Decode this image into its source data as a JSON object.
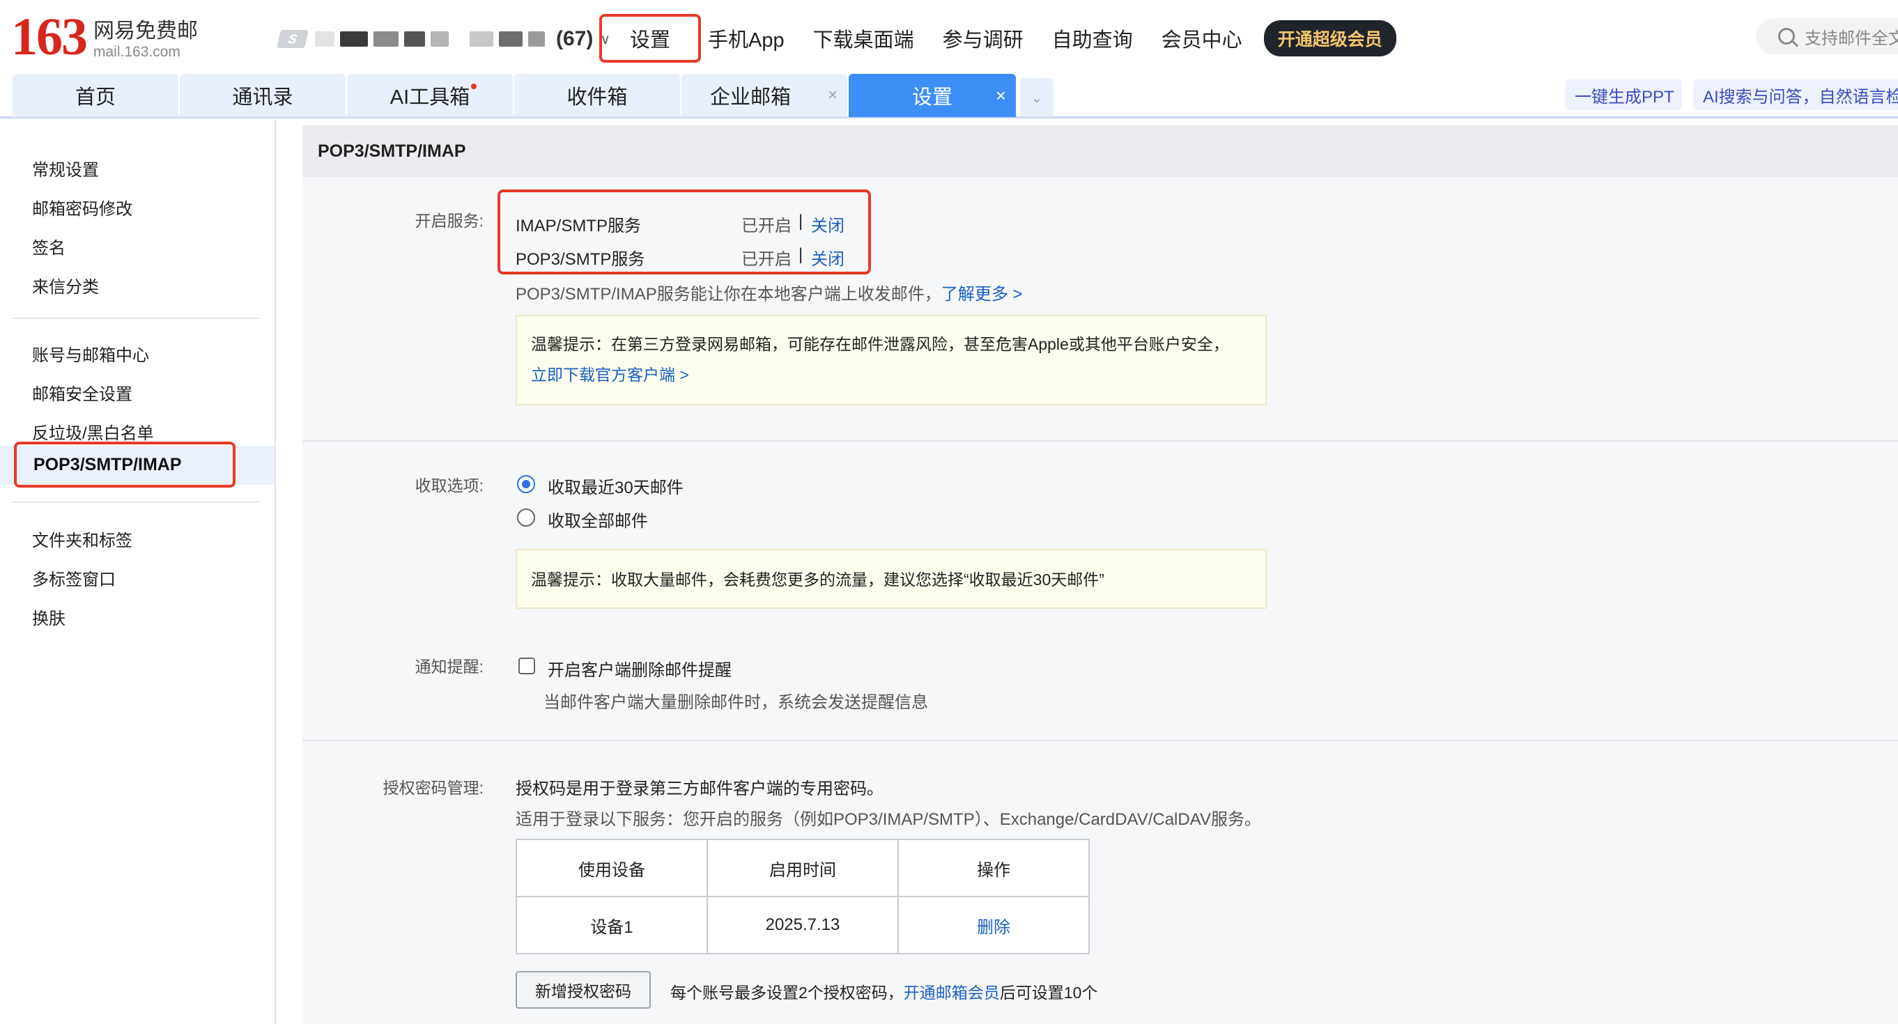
{
  "logo": {
    "number": "163",
    "name": "网易免费邮",
    "domain": "mail.163.com"
  },
  "account": {
    "badge": "S",
    "count": "(67)"
  },
  "topnav": {
    "items": [
      "设置",
      "手机App",
      "下载桌面端",
      "参与调研",
      "自助查询",
      "会员中心"
    ],
    "vip": "开通超级会员"
  },
  "search": {
    "placeholder": "支持邮件全文"
  },
  "tabs": {
    "items": [
      "首页",
      "通讯录",
      "AI工具箱",
      "收件箱",
      "企业邮箱",
      "设置"
    ],
    "close": "×",
    "more": "⌄",
    "ai_ppt": "一键生成PPT",
    "ai_search": "AI搜索与问答，自然语言检索"
  },
  "sidebar": {
    "group1": [
      "常规设置",
      "邮箱密码修改",
      "签名",
      "来信分类"
    ],
    "group2": [
      "账号与邮箱中心",
      "邮箱安全设置",
      "反垃圾/黑白名单",
      "POP3/SMTP/IMAP"
    ],
    "group3": [
      "文件夹和标签",
      "多标签窗口",
      "换肤"
    ]
  },
  "content": {
    "title": "POP3/SMTP/IMAP",
    "service": {
      "label": "开启服务:",
      "rows": [
        {
          "name": "IMAP/SMTP服务",
          "status": "已开启",
          "sep": "|",
          "action": "关闭"
        },
        {
          "name": "POP3/SMTP服务",
          "status": "已开启",
          "sep": "|",
          "action": "关闭"
        }
      ],
      "desc": "POP3/SMTP/IMAP服务能让你在本地客户端上收发邮件，",
      "learn_more": "了解更多 >",
      "tip_text": "温馨提示：在第三方登录网易邮箱，可能存在邮件泄露风险，甚至危害Apple或其他平台账户安全，",
      "tip_link": "立即下载官方客户端 >"
    },
    "receive": {
      "label": "收取选项:",
      "options": [
        "收取最近30天邮件",
        "收取全部邮件"
      ],
      "selected": 0,
      "tip": "温馨提示：收取大量邮件，会耗费您更多的流量，建议您选择“收取最近30天邮件”"
    },
    "notify": {
      "label": "通知提醒:",
      "checkbox": "开启客户端删除邮件提醒",
      "desc": "当邮件客户端大量删除邮件时，系统会发送提醒信息"
    },
    "auth": {
      "label": "授权密码管理:",
      "line1": "授权码是用于登录第三方邮件客户端的专用密码。",
      "line2": "适用于登录以下服务：您开启的服务（例如POP3/IMAP/SMTP）、Exchange/CardDAV/CalDAV服务。",
      "table": {
        "headers": [
          "使用设备",
          "启用时间",
          "操作"
        ],
        "rows": [
          {
            "device": "设备1",
            "time": "2025.7.13",
            "action": "删除"
          }
        ]
      },
      "add_button": "新增授权密码",
      "note_prefix": "每个账号最多设置2个授权密码，",
      "note_link": "开通邮箱会员",
      "note_suffix": "后可设置10个"
    }
  }
}
